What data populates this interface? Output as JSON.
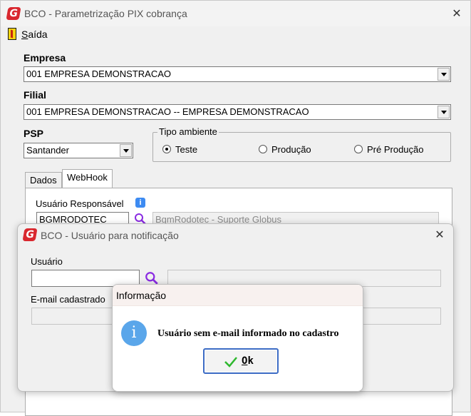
{
  "main_window": {
    "title": "BCO - Parametrização PIX cobrança",
    "menu": {
      "exit_label_underlined": "S",
      "exit_label_rest": "aída"
    },
    "empresa": {
      "label": "Empresa",
      "value": "001 EMPRESA DEMONSTRACAO"
    },
    "filial": {
      "label": "Filial",
      "value": "001 EMPRESA DEMONSTRACAO -- EMPRESA DEMONSTRACAO"
    },
    "psp": {
      "label": "PSP",
      "value": "Santander"
    },
    "tipo_ambiente": {
      "label": "Tipo ambiente",
      "options": [
        {
          "label": "Teste",
          "selected": true
        },
        {
          "label": "Produção",
          "selected": false
        },
        {
          "label": "Pré Produção",
          "selected": false
        }
      ]
    },
    "tabs": [
      {
        "label": "Dados",
        "active": false
      },
      {
        "label": "WebHook",
        "active": true
      }
    ],
    "webhook": {
      "usuario_label": "Usuário Responsável",
      "usuario_code": "BGMRODOTEC",
      "usuario_name": "BgmRodotec - Suporte Globus"
    }
  },
  "notification_dialog": {
    "title": "BCO - Usuário para notificação",
    "usuario_label": "Usuário",
    "usuario_value": "",
    "email_label": "E-mail cadastrado"
  },
  "message_box": {
    "title": "Informação",
    "message": "Usuário sem e-mail informado no cadastro",
    "ok_underlined": "O",
    "ok_rest": "k"
  },
  "colors": {
    "logo_red": "#d9272e",
    "info_blue": "#5aa6ea",
    "search_purple": "#8a2be2",
    "ok_check_green": "#2eb82e",
    "ok_border": "#3d6cc5"
  },
  "icons": [
    "app-logo-icon",
    "close-icon",
    "exit-door-icon",
    "dropdown-arrow-icon",
    "search-icon",
    "info-icon",
    "check-icon"
  ]
}
